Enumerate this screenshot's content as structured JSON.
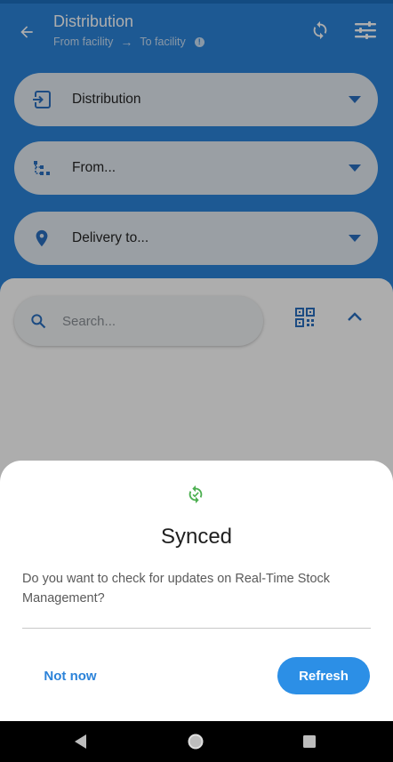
{
  "header": {
    "title": "Distribution",
    "from_label": "From facility",
    "arrow": "→",
    "to_label": "To facility",
    "info_glyph": "!",
    "back_icon": "arrow-back-icon",
    "sync_icon": "sync-icon",
    "filter_icon": "filter-settings-icon"
  },
  "selectors": [
    {
      "label": "Distribution",
      "icon": "exit-to-app-icon"
    },
    {
      "label": "From...",
      "icon": "hierarchy-icon"
    },
    {
      "label": "Delivery to...",
      "icon": "location-pin-icon"
    }
  ],
  "search": {
    "placeholder": "Search..."
  },
  "dialog": {
    "title": "Synced",
    "message": "Do you want to check for updates on Real-Time Stock Management?",
    "secondary_button": "Not now",
    "primary_button": "Refresh"
  },
  "colors": {
    "primary": "#2c83d9",
    "success": "#4caf50",
    "dialog_button": "#2c8fe6"
  }
}
